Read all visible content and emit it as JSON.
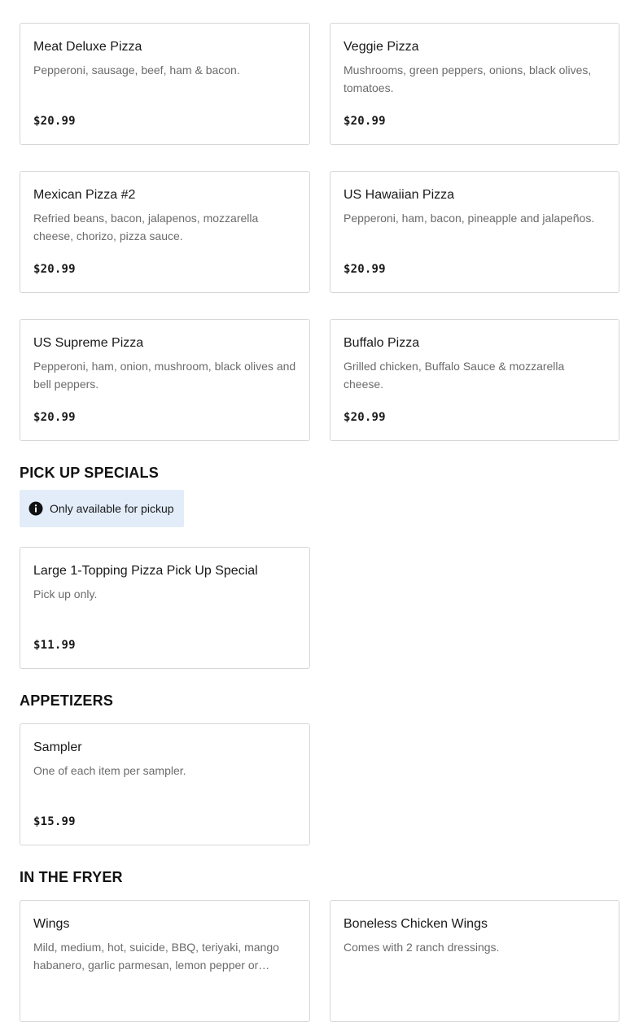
{
  "pizzas": [
    {
      "title": "Meat Deluxe Pizza",
      "desc": "Pepperoni, sausage, beef, ham & bacon.",
      "price": "$20.99"
    },
    {
      "title": "Veggie Pizza",
      "desc": "Mushrooms, green peppers, onions, black olives, tomatoes.",
      "price": "$20.99"
    },
    {
      "title": "Mexican Pizza #2",
      "desc": "Refried beans, bacon, jalapenos, mozzarella cheese, chorizo, pizza sauce.",
      "price": "$20.99"
    },
    {
      "title": "US Hawaiian Pizza",
      "desc": "Pepperoni, ham, bacon, pineapple and jalapeños.",
      "price": "$20.99"
    },
    {
      "title": "US Supreme Pizza",
      "desc": "Pepperoni, ham, onion, mushroom, black olives and bell peppers.",
      "price": "$20.99"
    },
    {
      "title": "Buffalo Pizza",
      "desc": "Grilled chicken, Buffalo Sauce & mozzarella cheese.",
      "price": "$20.99"
    }
  ],
  "pickup": {
    "heading": "PICK UP SPECIALS",
    "notice": "Only available for pickup",
    "notice_icon": "info-icon",
    "items": [
      {
        "title": "Large 1-Topping Pizza Pick Up Special",
        "desc": "Pick up only.",
        "price": "$11.99"
      }
    ]
  },
  "appetizers": {
    "heading": "APPETIZERS",
    "items": [
      {
        "title": "Sampler",
        "desc": "One of each item per sampler.",
        "price": "$15.99"
      }
    ]
  },
  "fryer": {
    "heading": "IN THE FRYER",
    "items": [
      {
        "title": "Wings",
        "desc": "Mild, medium, hot, suicide, BBQ, teriyaki, mango habanero, garlic parmesan, lemon pepper or…",
        "price": ""
      },
      {
        "title": "Boneless Chicken Wings",
        "desc": "Comes with 2 ranch dressings.",
        "price": ""
      }
    ]
  }
}
